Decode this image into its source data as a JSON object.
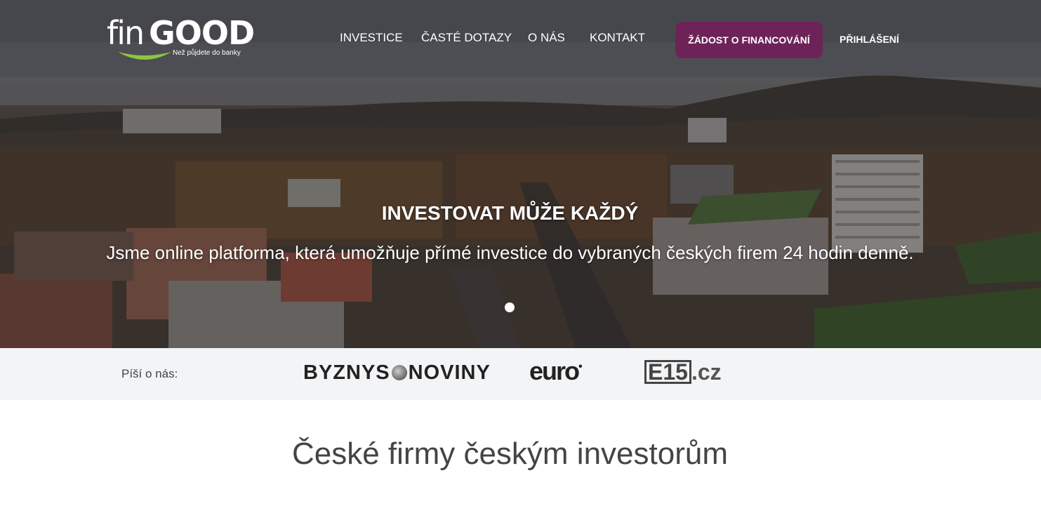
{
  "brand": {
    "logo_fin": "fin",
    "logo_good": "GOOD",
    "tagline": "Než půjdete do banky",
    "accent": "#8dc63f",
    "primary": "#6e2358"
  },
  "nav": {
    "items": [
      {
        "label": "INVESTICE"
      },
      {
        "label": "ČASTÉ DOTAZY"
      },
      {
        "label": "O NÁS"
      },
      {
        "label": "KONTAKT"
      }
    ],
    "cta_label": "ŽÁDOST O FINANCOVÁNÍ",
    "login_label": "PŘIHLÁŠENÍ"
  },
  "hero": {
    "title": "INVESTOVAT MŮŽE KAŽDÝ",
    "subtitle": "Jsme online platforma, která umožňuje přímé investice do vybraných českých firem 24 hodin denně.",
    "slide_count": 1,
    "active_slide": 1
  },
  "press": {
    "label": "Píší o nás:",
    "logos": [
      {
        "name": "byznys-noviny-logo",
        "part1": "BYZNYS",
        "part2": "NOVINY"
      },
      {
        "name": "euro-logo",
        "text": "euro",
        "mark": "•"
      },
      {
        "name": "e15-logo",
        "box": "E15",
        "suffix": ".cz"
      }
    ]
  },
  "main": {
    "heading": "České firmy českým investorům"
  }
}
